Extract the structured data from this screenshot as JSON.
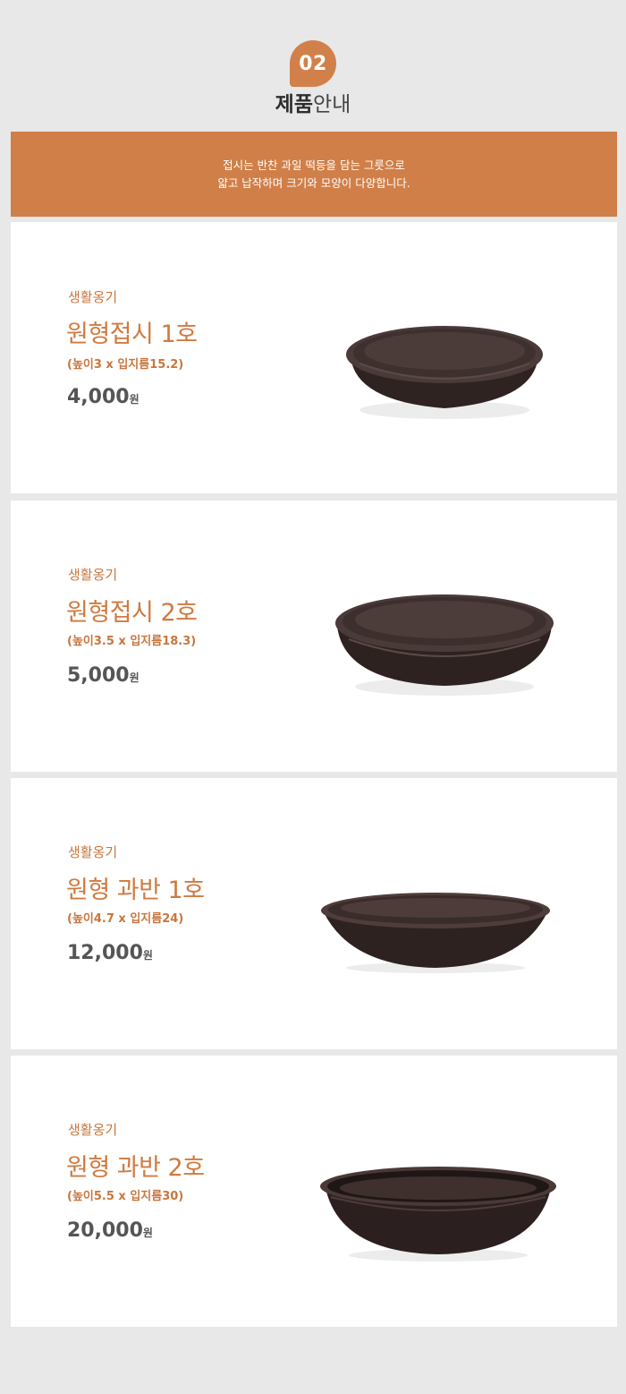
{
  "header": {
    "badge": "02",
    "title_bold": "제품",
    "title_light": "안내"
  },
  "banner": {
    "line1": "접시는 반찬 과일 떡등을 담는 그릇으로",
    "line2": "얇고 납작하며 크기와 모양이 다양합니다."
  },
  "products": [
    {
      "category": "생활옹기",
      "name": "원형접시 1호",
      "dimensions": "(높이3 x 입지름15.2)",
      "price": "4,000",
      "unit": "원",
      "image": "round-dark-plate"
    },
    {
      "category": "생활옹기",
      "name": "원형접시 2호",
      "dimensions": "(높이3.5 x 입지름18.3)",
      "price": "5,000",
      "unit": "원",
      "image": "round-dark-plate"
    },
    {
      "category": "생활옹기",
      "name": "원형 과반 1호",
      "dimensions": "(높이4.7 x 입지름24)",
      "price": "12,000",
      "unit": "원",
      "image": "round-dark-fruit-bowl"
    },
    {
      "category": "생활옹기",
      "name": "원형 과반 2호",
      "dimensions": "(높이5.5 x 입지름30)",
      "price": "20,000",
      "unit": "원",
      "image": "round-dark-fruit-bowl"
    }
  ],
  "colors": {
    "accent": "#d07f48",
    "background": "#e8e8e8",
    "card": "#ffffff",
    "price_text": "#555555",
    "plate": "#3b2c2a"
  }
}
